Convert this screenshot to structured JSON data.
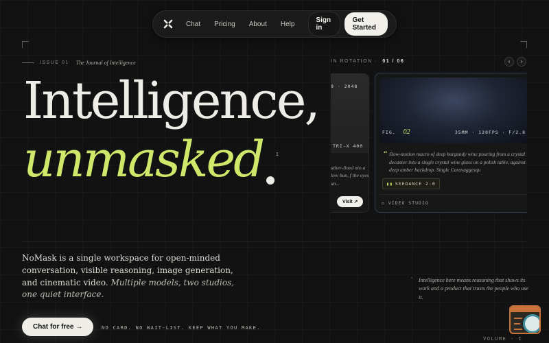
{
  "nav": {
    "links": [
      "Chat",
      "Pricing",
      "About",
      "Help"
    ],
    "sign_in": "Sign in",
    "get_started": "Get Started"
  },
  "issue": {
    "label": "ISSUE 01",
    "journal": "The Journal of Intelligence"
  },
  "hero": {
    "line1": "Intelligence,",
    "line2": "unmasked",
    "sup": "1"
  },
  "rotation": {
    "label": "IN ROTATION ·",
    "count": "01 / 06",
    "prev": "‹",
    "next": "›"
  },
  "card_left": {
    "top_label": "9 · 2048",
    "film_label": "TRI-X 400",
    "quote": "ather-lined nto a low bun, f the eyes an...",
    "visit": "Visit ↗"
  },
  "card_right": {
    "fig_label": "FIG.",
    "fig_num": "02",
    "specs": "35MM · 120FPS · F/2.8",
    "description": "Slow-motion macro of deep burgundy wine pouring from a crystal decanter into a single crystal wine glass on a polish table, against a deep umber backdrop. Single Caravaggesqu",
    "model": "SEEDANCE 2.0",
    "studio": "VIDEO STUDIO"
  },
  "lead": {
    "text": "NoMask is a single workspace for open-minded conversation, visible reasoning, image generation, and cinematic video.",
    "italic": "Multiple models, two studios, one quiet interface."
  },
  "side_quote": "Intelligence here means reasoning that shows its work and a product that trusts the people who use it.",
  "cta": {
    "label": "Chat for free →",
    "note": "NO CARD. NO WAIT-LIST. KEEP WHAT YOU MAKE."
  },
  "volume": "VOLUME · I",
  "colors": {
    "accent": "#cfe86a",
    "background": "#121212",
    "text": "#eeece6"
  },
  "icons": [
    "logo-cross-icon",
    "chevron-left-icon",
    "chevron-right-icon",
    "quote-icon",
    "video-icon"
  ]
}
